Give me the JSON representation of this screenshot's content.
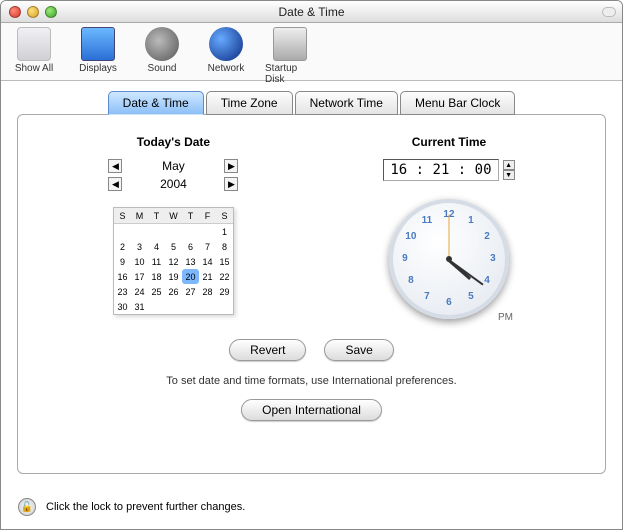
{
  "window": {
    "title": "Date & Time"
  },
  "toolbar_items": [
    {
      "name": "show-all",
      "label": "Show All",
      "iconClass": "icon-showall"
    },
    {
      "name": "displays",
      "label": "Displays",
      "iconClass": "icon-displays"
    },
    {
      "name": "sound",
      "label": "Sound",
      "iconClass": "icon-sound"
    },
    {
      "name": "network",
      "label": "Network",
      "iconClass": "icon-network"
    },
    {
      "name": "startup-disk",
      "label": "Startup Disk",
      "iconClass": "icon-startup"
    }
  ],
  "tabs": [
    {
      "label": "Date & Time",
      "active": true
    },
    {
      "label": "Time Zone",
      "active": false
    },
    {
      "label": "Network Time",
      "active": false
    },
    {
      "label": "Menu Bar Clock",
      "active": false
    }
  ],
  "date_section": {
    "heading": "Today's Date",
    "month": "May",
    "year": "2004",
    "weekday_headers": [
      "S",
      "M",
      "T",
      "W",
      "T",
      "F",
      "S"
    ],
    "weeks": [
      [
        "",
        "",
        "",
        "",
        "",
        "",
        "1"
      ],
      [
        "2",
        "3",
        "4",
        "5",
        "6",
        "7",
        "8"
      ],
      [
        "9",
        "10",
        "11",
        "12",
        "13",
        "14",
        "15"
      ],
      [
        "16",
        "17",
        "18",
        "19",
        "20",
        "21",
        "22"
      ],
      [
        "23",
        "24",
        "25",
        "26",
        "27",
        "28",
        "29"
      ],
      [
        "30",
        "31",
        "",
        "",
        "",
        "",
        ""
      ]
    ],
    "selected_day": "20"
  },
  "time_section": {
    "heading": "Current Time",
    "time_value": "16 : 21 : 00",
    "ampm": "PM",
    "hour_angle_deg": 41,
    "minute_angle_deg": 36,
    "second_angle_deg": -90
  },
  "buttons": {
    "revert": "Revert",
    "save": "Save",
    "open_intl": "Open International"
  },
  "hint": "To set date and time formats, use International preferences.",
  "lock": {
    "text": "Click the lock to prevent further changes."
  },
  "glyphs": {
    "left": "◀",
    "right": "▶",
    "up": "▲",
    "down": "▼",
    "lock": "🔓"
  },
  "clock_numbers": [
    "12",
    "1",
    "2",
    "3",
    "4",
    "5",
    "6",
    "7",
    "8",
    "9",
    "10",
    "11"
  ]
}
